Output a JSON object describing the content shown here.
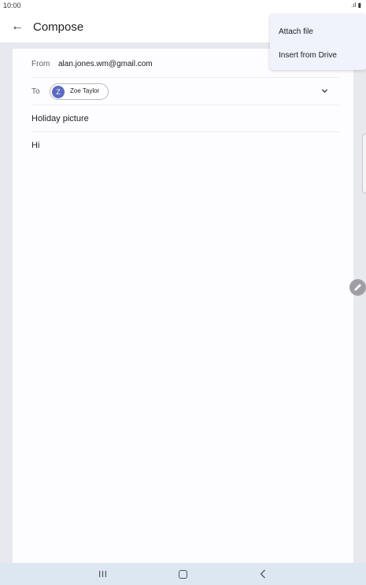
{
  "status": {
    "time": "10:00",
    "icons": ".ıl ▮"
  },
  "header": {
    "title": "Compose"
  },
  "compose": {
    "from_label": "From",
    "from_value": "alan.jones.wm@gmail.com",
    "to_label": "To",
    "recipient": {
      "initial": "Z",
      "name": "Zoe Taylor",
      "color": "#5c6bc0"
    },
    "subject": "Holiday picture",
    "body": "Hi"
  },
  "menu": {
    "items": [
      "Attach file",
      "Insert from Drive"
    ]
  },
  "colors": {
    "menu_bg": "#f0f3fb",
    "nav_bg": "#dde7f2",
    "fab": "#9e9ea3"
  },
  "icons": {
    "back": "arrow-left-icon",
    "expand": "chevron-down-icon",
    "fab": "pencil-icon"
  }
}
